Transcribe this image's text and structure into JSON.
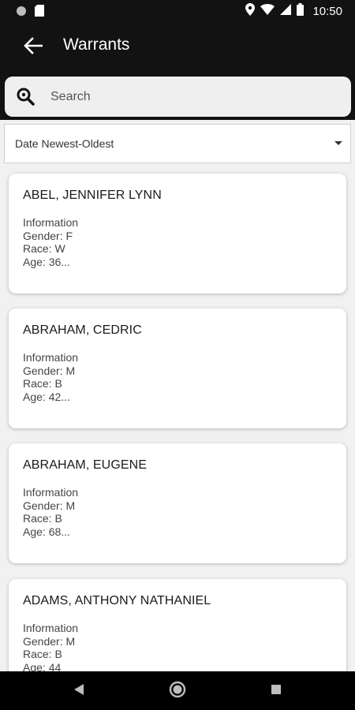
{
  "status_bar": {
    "time": "10:50"
  },
  "app_bar": {
    "title": "Warrants",
    "back_icon": "arrow-left-icon"
  },
  "search": {
    "placeholder": "Search",
    "value": ""
  },
  "sort": {
    "selected": "Date Newest-Oldest"
  },
  "records": [
    {
      "name": "ABEL, JENNIFER LYNN",
      "info_label": "Information",
      "gender": "Gender: F",
      "race": "Race: W",
      "age": "Age: 36..."
    },
    {
      "name": "ABRAHAM, CEDRIC",
      "info_label": "Information",
      "gender": "Gender: M",
      "race": "Race: B",
      "age": "Age: 42..."
    },
    {
      "name": "ABRAHAM, EUGENE",
      "info_label": "Information",
      "gender": "Gender: M",
      "race": "Race: B",
      "age": "Age: 68..."
    },
    {
      "name": "ADAMS, ANTHONY NATHANIEL",
      "info_label": "Information",
      "gender": "Gender: M",
      "race": "Race: B",
      "age": "Age: 44"
    }
  ],
  "colors": {
    "app_bar": "#121212",
    "background": "#f1f1f1",
    "card": "#ffffff"
  }
}
